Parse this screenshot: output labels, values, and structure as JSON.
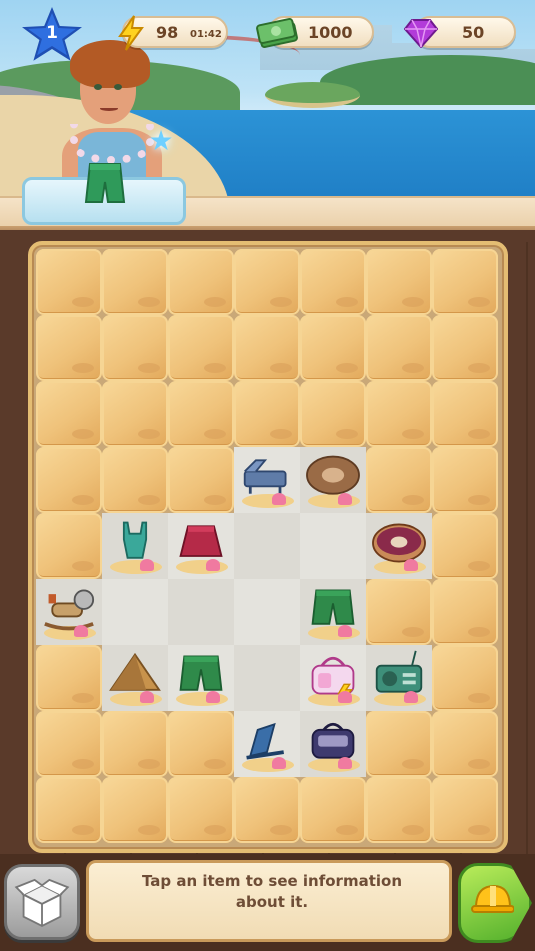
{
  "hud": {
    "level": "1",
    "energy": "98",
    "energy_timer": "01:42",
    "cash": "1000",
    "gems": "50"
  },
  "info": {
    "message": "Tap an item to see information about it."
  },
  "board": {
    "columns": 7,
    "rows": 9,
    "cells": [
      [
        "sand",
        "sand",
        "sand",
        "sand",
        "sand",
        "sand",
        "sand"
      ],
      [
        "sand",
        "sand",
        "sand",
        "sand",
        "sand",
        "sand",
        "sand"
      ],
      [
        "sand",
        "sand",
        "sand",
        "sand",
        "sand",
        "sand",
        "sand"
      ],
      [
        "sand",
        "sand",
        "sand",
        "beach-lounger-icon",
        "inflatable-ring-icon",
        "sand",
        "sand"
      ],
      [
        "sand",
        "swimsuit-top-icon",
        "skirt-icon",
        "empty",
        "empty",
        "donut-icon",
        "sand"
      ],
      [
        "rocking-horse-icon",
        "empty",
        "empty",
        "empty",
        "shorts-icon",
        "sand",
        "sand"
      ],
      [
        "sand",
        "pyramid-icon",
        "shorts-icon",
        "empty",
        "beach-bag-icon",
        "radio-icon",
        "sand"
      ],
      [
        "sand",
        "sand",
        "sand",
        "beach-chair-icon",
        "cosmetic-bag-icon",
        "sand",
        "sand"
      ],
      [
        "sand",
        "sand",
        "sand",
        "sand",
        "sand",
        "sand",
        "sand"
      ]
    ]
  },
  "colors": {
    "sand_tile": "#efc27a",
    "board_frame": "#e4bd73",
    "empty_cell": "#e4e3dd",
    "build_button": "#53b02c",
    "level_star": "#2f6fe0"
  }
}
